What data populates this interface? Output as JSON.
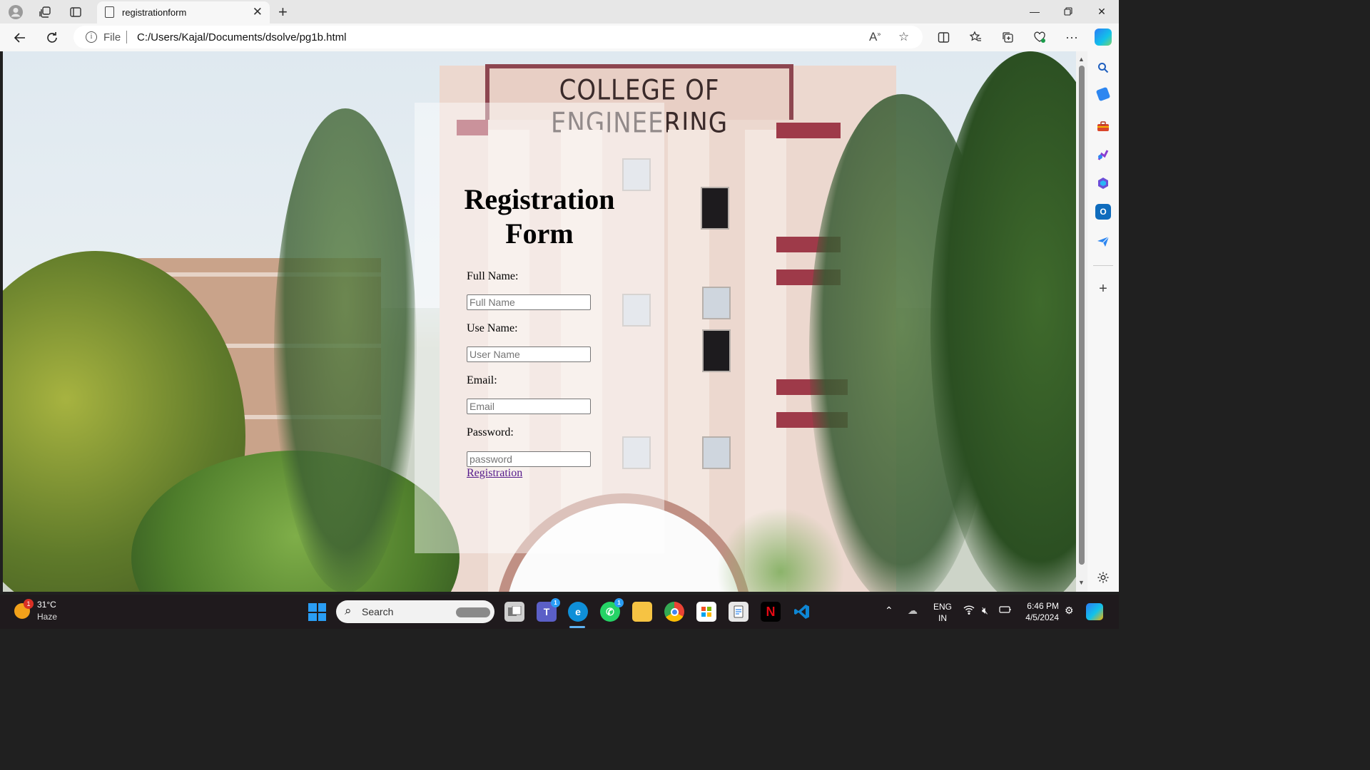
{
  "browser": {
    "tab_title": "registrationform",
    "address_scheme_label": "File",
    "url": "C:/Users/Kajal/Documents/dsolve/pg1b.html"
  },
  "page": {
    "background_sign": "COLLEGE OF ENGINEERING",
    "form": {
      "title_line1": "Registration",
      "title_line2": "Form",
      "fields": [
        {
          "label": "Full Name:",
          "placeholder": "Full Name",
          "value": ""
        },
        {
          "label": "Use Name:",
          "placeholder": "User Name",
          "value": ""
        },
        {
          "label": "Email:",
          "placeholder": "Email",
          "value": ""
        },
        {
          "label": "Password:",
          "placeholder": "password",
          "value": ""
        }
      ],
      "submit_link": "Registration"
    }
  },
  "taskbar": {
    "weather": {
      "temp": "31°C",
      "condition": "Haze",
      "badge": "1"
    },
    "search_label": "Search",
    "teams_badge": "1",
    "whatsapp_badge": "1",
    "language_line1": "ENG",
    "language_line2": "IN",
    "time": "6:46 PM",
    "date": "4/5/2024"
  },
  "icons": {
    "tabbar": [
      "profile-icon",
      "workspaces-icon",
      "tab-actions-icon",
      "page-icon",
      "close-icon",
      "plus-icon"
    ],
    "navbar": [
      "back-arrow-icon",
      "refresh-icon",
      "info-icon",
      "read-aloud-icon",
      "favorite-star-icon",
      "split-screen-icon",
      "favorites-icon",
      "collections-icon",
      "browser-essentials-icon",
      "more-icon",
      "copilot-icon"
    ],
    "sidebar": [
      "search-icon",
      "shopping-tag-icon",
      "tools-icon",
      "games-icon",
      "microsoft365-icon",
      "outlook-icon",
      "send-icon",
      "add-icon",
      "settings-gear-icon"
    ]
  },
  "colors": {
    "link_visited": "#551a8b",
    "card_overlay": "rgba(255,255,255,0.45)",
    "taskbar_bg": "#1f1a1d",
    "accent_blue": "#2a9df4"
  }
}
